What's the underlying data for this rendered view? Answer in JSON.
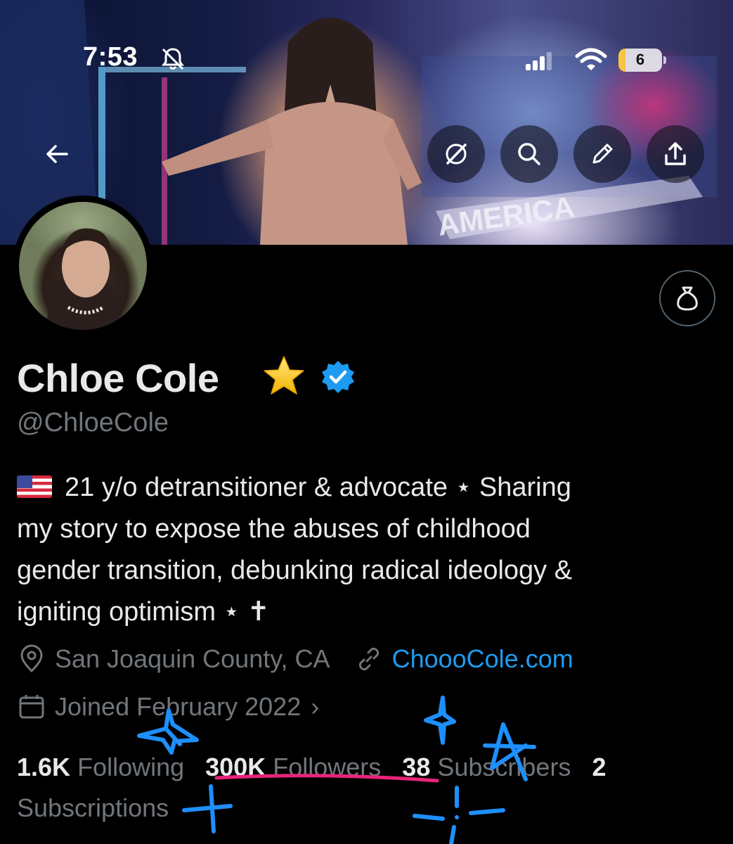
{
  "status_bar": {
    "time": "7:53",
    "battery": "6"
  },
  "profile": {
    "name": "Chloe Cole",
    "handle": "@ChloeCole",
    "bio_line1": "21 y/o detransitioner & advocate ⋆ Sharing",
    "bio_line2": "my story to expose the abuses of childhood",
    "bio_line3": "gender transition, debunking radical ideology &",
    "bio_line4": "igniting optimism ⋆ ✝",
    "location": "San Joaquin County, CA",
    "website": "ChoooCole.com",
    "joined": "Joined February 2022",
    "joined_chevron": "›"
  },
  "stats": {
    "following_count": "1.6K",
    "following_label": "Following",
    "followers_count": "300K",
    "followers_label": "Followers",
    "subscribers_count": "38",
    "subscribers_label": "Subscribers",
    "subscriptions_count": "2",
    "subscriptions_label": "Subscriptions"
  },
  "colors": {
    "accent": "#1d9bf0",
    "muted": "#71767b",
    "scribble_blue": "#1e8fff",
    "underline_pink": "#e8247a"
  },
  "icons": [
    "bell-slash-icon",
    "signal-icon",
    "wifi-icon",
    "back-arrow-icon",
    "grok-icon",
    "search-icon",
    "edit-pencil-icon",
    "share-icon",
    "money-bag-icon",
    "star-icon",
    "verified-icon",
    "flag-us-icon",
    "location-pin-icon",
    "link-icon",
    "calendar-icon"
  ]
}
